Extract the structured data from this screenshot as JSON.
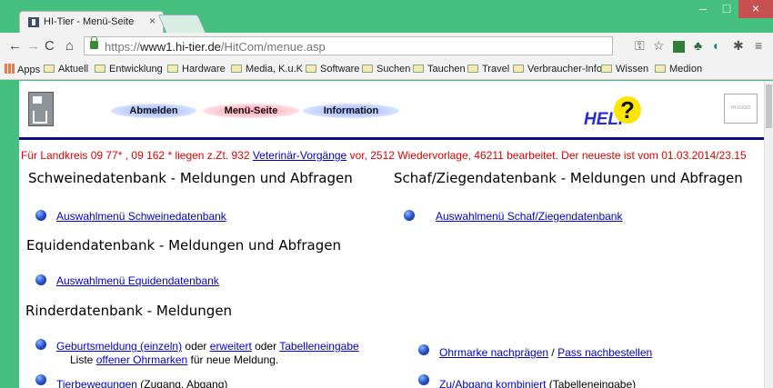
{
  "browser": {
    "tab_title": "HI-Tier - Menü-Seite",
    "tab_close": "×",
    "window_min": "–",
    "window_max": "□",
    "window_close": "×",
    "url_prefix": "https://",
    "url_host": "www1.hi-tier.de",
    "url_path": "/HitCom/menue.asp"
  },
  "bookmarks": [
    "Apps",
    "Aktuell",
    "Entwicklung",
    "Hardware",
    "Media, K.u.K",
    "Software",
    "Suchen",
    "Tauchen",
    "Travel",
    "Verbraucher-Info",
    "Wissen",
    "Medion"
  ],
  "header": {
    "nav": [
      "Abmelden",
      "Menü-Seite",
      "Information"
    ],
    "help_text": "HELP",
    "help_mark": "?",
    "logo_right": "HI-LOGO"
  },
  "notice": {
    "part1": "Für Landkreis 09 77* , 09 162 * liegen z.Zt. 932 ",
    "link": "Veterinär-Vorgänge",
    "part2": " vor, 2512 Wiedervorlage, 46211 bearbeitet. Der neueste ist vom 01.03.2014/23.15"
  },
  "sections": {
    "schwein_title": "Schweinedatenbank - Meldungen und Abfragen",
    "schwein_link": "Auswahlmenü Schweinedatenbank",
    "schaf_title": "Schaf/Ziegendatenbank - Meldungen und Abfragen",
    "schaf_link": "Auswahlmenü Schaf/Ziegendatenbank",
    "equiden_title": "Equidendatenbank - Meldungen und Abfragen",
    "equiden_link": "Auswahlmenü Equidendatenbank",
    "rinder_title": "Rinderdatenbank - Meldungen"
  },
  "rinder": {
    "geburt_link": "Geburtsmeldung (einzeln)",
    "oder1": " oder ",
    "erweitert_link": "erweitert",
    "oder2": " oder ",
    "tabelle_link": "Tabelleneingabe",
    "liste_prefix": "Liste ",
    "ohrmarken_link": "offener Ohrmarken",
    "liste_suffix": " für neue Meldung.",
    "ohrmarke_link": "Ohrmarke nachprägen",
    "slash": " / ",
    "pass_link": "Pass nachbestellen",
    "tierbew_link": "Tierbewegungen",
    "tierbew_suffix": " (Zugang, Abgang)",
    "zuab_link": "Zu/Abgang kombiniert",
    "zuab_suffix": " (Tabelleneingabe)"
  }
}
